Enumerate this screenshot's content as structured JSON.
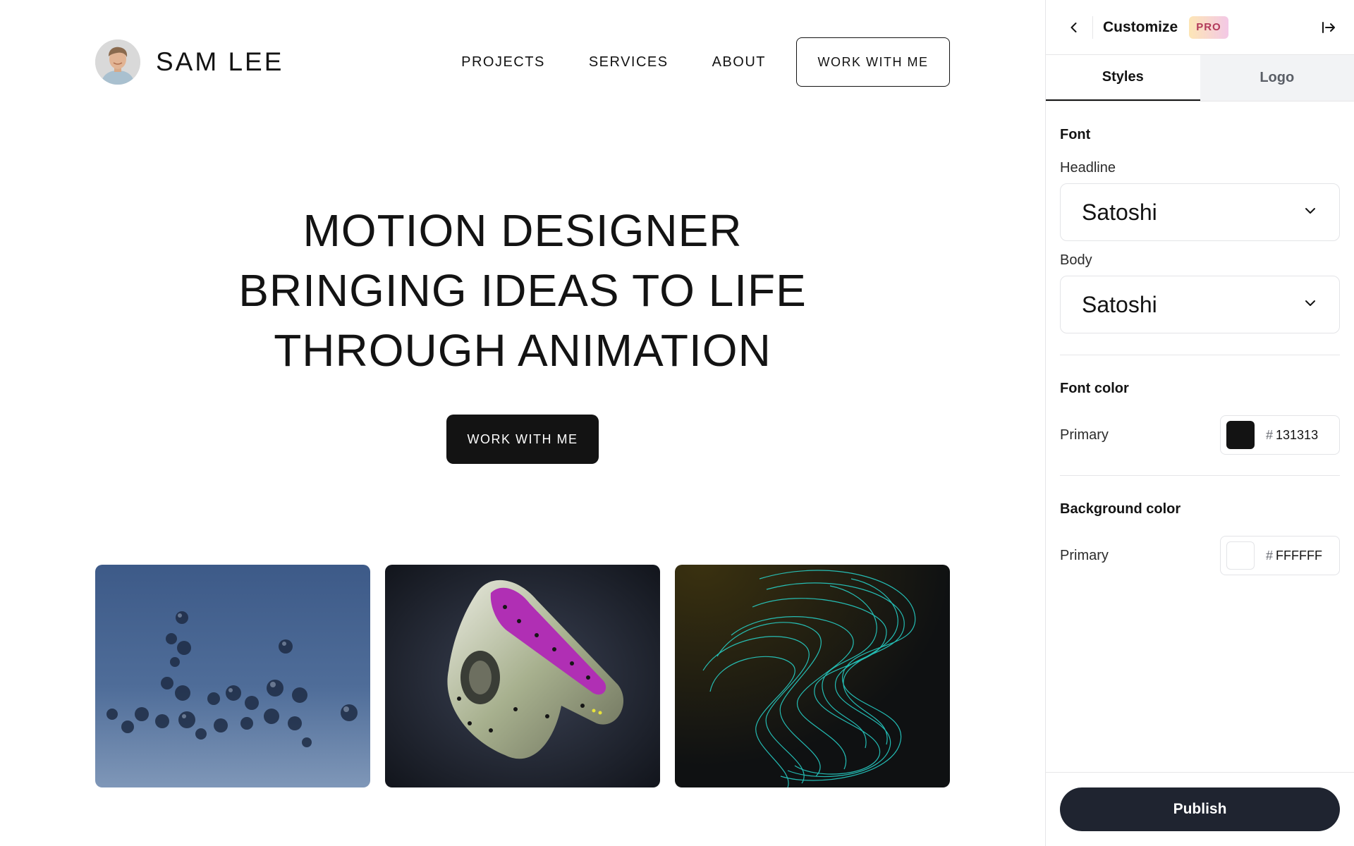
{
  "site": {
    "brand_name": "SAM LEE",
    "nav": {
      "projects": "PROJECTS",
      "services": "SERVICES",
      "about": "ABOUT",
      "cta": "WORK WITH ME"
    },
    "hero": {
      "title": "MOTION DESIGNER BRINGING IDEAS TO LIFE THROUGH ANIMATION",
      "cta": "WORK WITH ME"
    }
  },
  "panel": {
    "title": "Customize",
    "badge": "PRO",
    "tabs": [
      "Styles",
      "Logo"
    ],
    "font": {
      "section": "Font",
      "headline_label": "Headline",
      "headline_value": "Satoshi",
      "body_label": "Body",
      "body_value": "Satoshi"
    },
    "font_color": {
      "section": "Font color",
      "primary_label": "Primary",
      "hash": "#",
      "value": "131313",
      "swatch": "#131313"
    },
    "background_color": {
      "section": "Background color",
      "primary_label": "Primary",
      "hash": "#",
      "value": "FFFFFF",
      "swatch": "#FFFFFF"
    },
    "publish_label": "Publish"
  },
  "icons": {
    "back": "chevron-left-icon",
    "collapse": "collapse-right-icon",
    "select": "chevron-down-icon"
  }
}
